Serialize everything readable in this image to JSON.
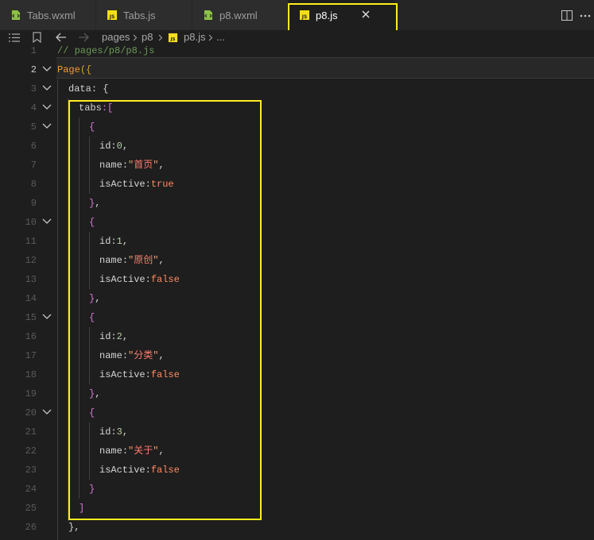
{
  "tabs": [
    {
      "label": "Tabs.wxml",
      "icon": "wxml-file-icon",
      "active": false
    },
    {
      "label": "Tabs.js",
      "icon": "js-file-icon",
      "active": false
    },
    {
      "label": "p8.wxml",
      "icon": "wxml-file-icon",
      "active": false
    },
    {
      "label": "p8.js",
      "icon": "js-file-icon",
      "active": true
    }
  ],
  "breadcrumb": {
    "items": [
      "pages",
      "p8",
      "p8.js",
      "..."
    ]
  },
  "editor": {
    "line_numbers": [
      "1",
      "2",
      "3",
      "4",
      "5",
      "6",
      "7",
      "8",
      "9",
      "10",
      "11",
      "12",
      "13",
      "14",
      "15",
      "16",
      "17",
      "18",
      "19",
      "20",
      "21",
      "22",
      "23",
      "24",
      "25",
      "26"
    ],
    "current_line": "2",
    "code": {
      "l1": "// pages/p8/p8.js",
      "l2_fn": "Page",
      "l2_open": "({",
      "l3_key": "data",
      "l3_rest": ": {",
      "l4_key": "tabs",
      "l4_rest": ":[",
      "open_brace": "{",
      "close_brace_comma": "},",
      "close_brace": "}",
      "id_key": "id",
      "name_key": "name",
      "active_key": "isActive",
      "items": [
        {
          "id": "0",
          "name": "首页",
          "active": "true"
        },
        {
          "id": "1",
          "name": "原创",
          "active": "false"
        },
        {
          "id": "2",
          "name": "分类",
          "active": "false"
        },
        {
          "id": "3",
          "name": "关于",
          "active": "false"
        }
      ],
      "l25": "]",
      "l26": "},"
    }
  },
  "colors": {
    "highlight": "#ffee1c",
    "js_icon": "#f5de19",
    "wxml_icon": "#8dc149"
  }
}
